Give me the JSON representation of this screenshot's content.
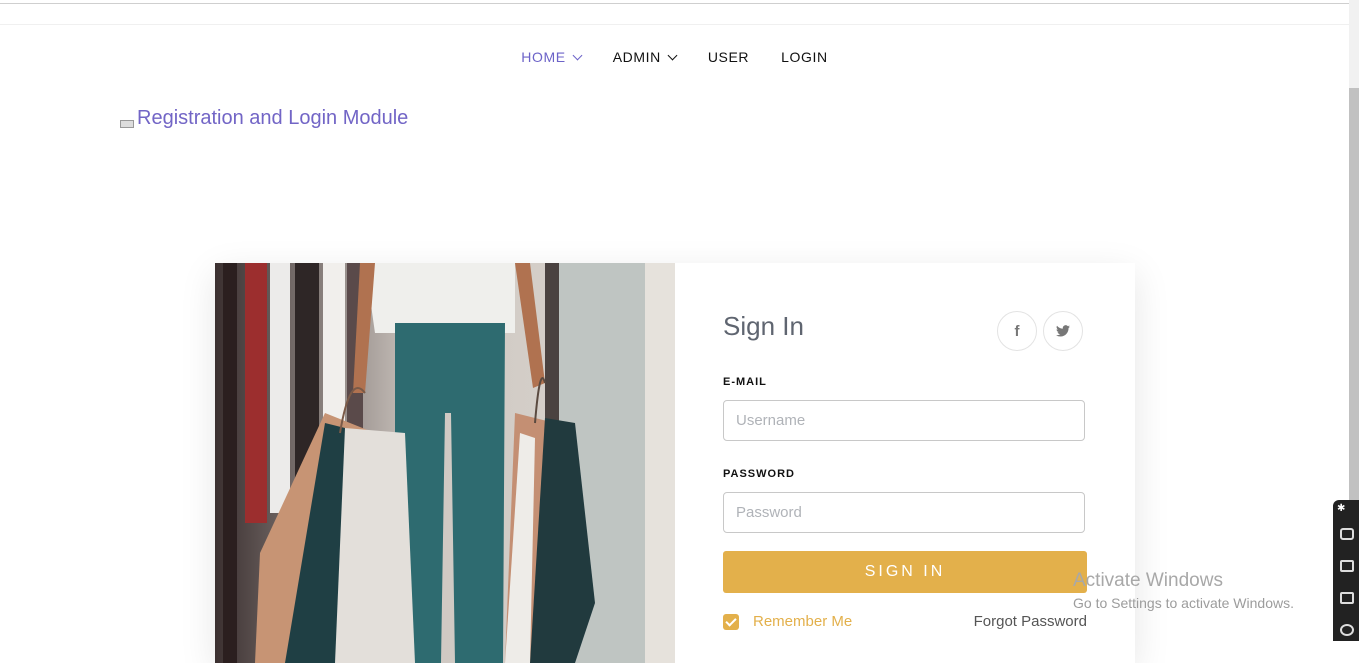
{
  "nav": {
    "items": [
      {
        "label": "HOME",
        "active": true,
        "dropdown": true
      },
      {
        "label": "ADMIN",
        "active": false,
        "dropdown": true
      },
      {
        "label": "USER",
        "active": false,
        "dropdown": false
      },
      {
        "label": "LOGIN",
        "active": false,
        "dropdown": false
      }
    ]
  },
  "brand": {
    "title": "Registration and Login Module"
  },
  "signin": {
    "title": "Sign In",
    "social": [
      {
        "icon": "facebook-icon",
        "glyph": "f"
      },
      {
        "icon": "twitter-icon",
        "glyph": "t"
      }
    ],
    "email_label": "E-MAIL",
    "email_placeholder": "Username",
    "password_label": "PASSWORD",
    "password_placeholder": "Password",
    "submit_label": "SIGN IN",
    "remember_label": "Remember Me",
    "remember_checked": true,
    "forgot_label": "Forgot Password"
  },
  "watermark": {
    "title": "Activate Windows",
    "subtitle": "Go to Settings to activate Windows."
  },
  "colors": {
    "accent": "#e3b04b",
    "nav_active": "#6c63c8",
    "brand": "#7265c6"
  }
}
